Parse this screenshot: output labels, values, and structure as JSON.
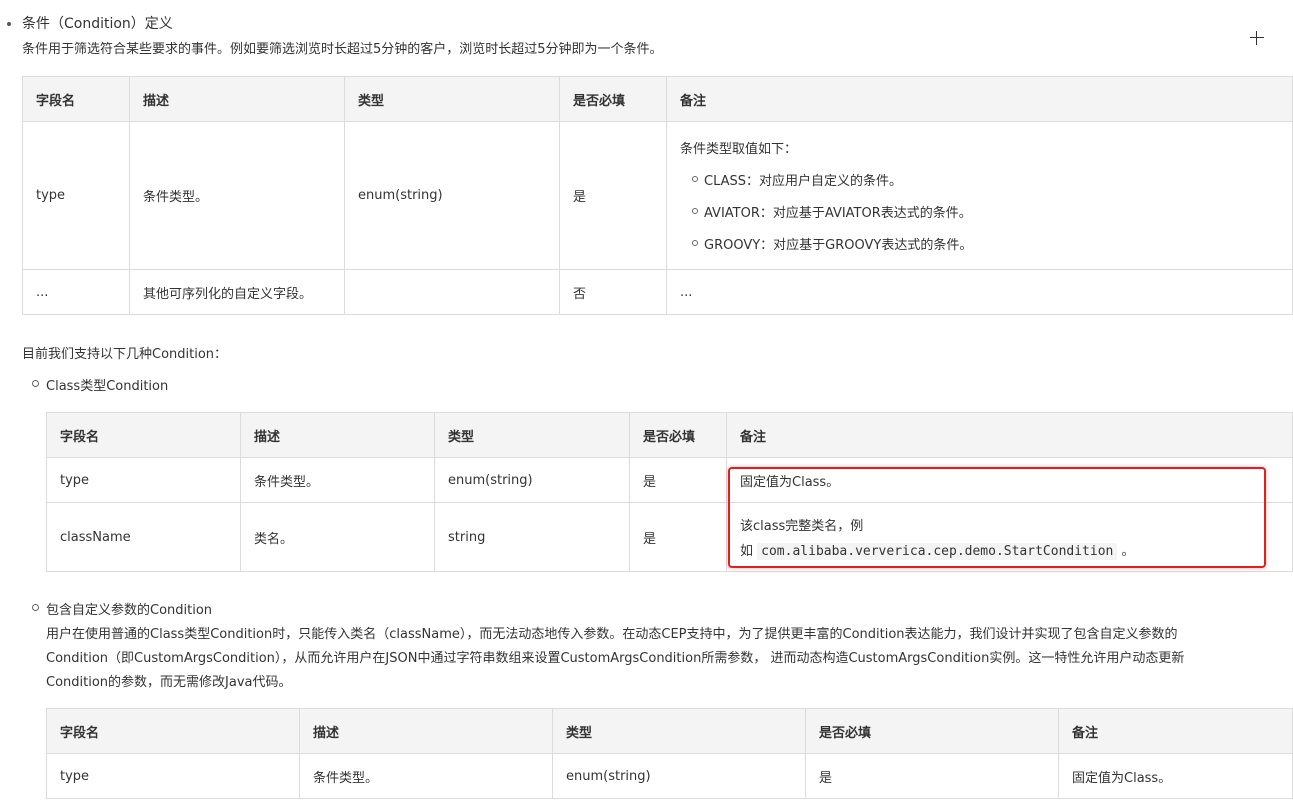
{
  "section": {
    "title": "条件（Condition）定义",
    "desc": "条件用于筛选符合某些要求的事件。例如要筛选浏览时长超过5分钟的客户，浏览时长超过5分钟即为一个条件。"
  },
  "table_headers": [
    "字段名",
    "描述",
    "类型",
    "是否必填",
    "备注"
  ],
  "table1": {
    "rows": [
      {
        "field": "type",
        "desc": "条件类型。",
        "type": "enum(string)",
        "required": "是",
        "note_intro": "条件类型取值如下：",
        "note_items": [
          "CLASS：对应用户自定义的条件。",
          "AVIATOR：对应基于AVIATOR表达式的条件。",
          "GROOVY：对应基于GROOVY表达式的条件。"
        ]
      },
      {
        "field": "...",
        "desc": "其他可序列化的自定义字段。",
        "type": "",
        "required": "否",
        "note": "..."
      }
    ]
  },
  "support_text": "目前我们支持以下几种Condition：",
  "class_condition": {
    "title": "Class类型Condition",
    "rows": [
      {
        "field": "type",
        "desc": "条件类型。",
        "type": "enum(string)",
        "required": "是",
        "note": "固定值为Class。"
      },
      {
        "field": "className",
        "desc": "类名。",
        "type": "string",
        "required": "是",
        "note_line1": "该class完整类名，例",
        "note_prefix": "如",
        "note_code": "com.alibaba.ververica.cep.demo.StartCondition",
        "note_suffix": "。"
      }
    ]
  },
  "custom_condition": {
    "title": "包含自定义参数的Condition",
    "para_lines": [
      "用户在使用普通的Class类型Condition时，只能传入类名（className），而无法动态地传入参数。在动态CEP支持中，为了提供更丰富的Condition表达能力，我们设计并实现了包含自定义参数的",
      "Condition（即CustomArgsCondition），从而允许用户在JSON中通过字符串数组来设置CustomArgsCondition所需参数， 进而动态构造CustomArgsCondition实例。这一特性允许用户动态更新",
      "Condition的参数，而无需修改Java代码。"
    ],
    "rows": [
      {
        "field": "type",
        "desc": "条件类型。",
        "type": "enum(string)",
        "required": "是",
        "note": "固定值为Class。"
      }
    ]
  },
  "highlight_color": "#e02020"
}
